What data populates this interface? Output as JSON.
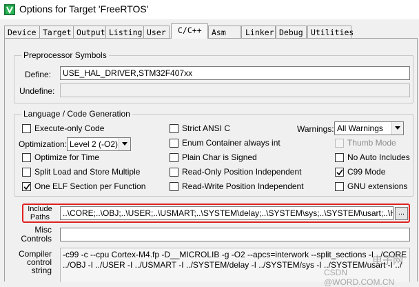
{
  "window": {
    "title": "Options for Target 'FreeRTOS'"
  },
  "tabs": [
    {
      "label": "Device"
    },
    {
      "label": "Target"
    },
    {
      "label": "Output"
    },
    {
      "label": "Listing"
    },
    {
      "label": "User"
    },
    {
      "label": "C/C++",
      "active": true
    },
    {
      "label": "Asm"
    },
    {
      "label": "Linker"
    },
    {
      "label": "Debug"
    },
    {
      "label": "Utilities"
    }
  ],
  "preprocessor": {
    "legend": "Preprocessor Symbols",
    "define_label": "Define:",
    "define_value": "USE_HAL_DRIVER,STM32F407xx",
    "undefine_label": "Undefine:",
    "undefine_value": ""
  },
  "language": {
    "legend": "Language / Code Generation",
    "execute_only": {
      "label": "Execute-only Code",
      "checked": false
    },
    "optimization_label": "Optimization:",
    "optimization_value": "Level 2 (-O2)",
    "optimize_time": {
      "label": "Optimize for Time",
      "checked": false
    },
    "split_load": {
      "label": "Split Load and Store Multiple",
      "checked": false
    },
    "one_elf": {
      "label": "One ELF Section per Function",
      "checked": true
    },
    "strict_ansi": {
      "label": "Strict ANSI C",
      "checked": false
    },
    "enum_container": {
      "label": "Enum Container always int",
      "checked": false
    },
    "plain_char": {
      "label": "Plain Char is Signed",
      "checked": false
    },
    "readonly_pi": {
      "label": "Read-Only Position Independent",
      "checked": false
    },
    "readwrite_pi": {
      "label": "Read-Write Position Independent",
      "checked": false
    },
    "warnings_label": "Warnings:",
    "warnings_value": "All Warnings",
    "thumb_mode": {
      "label": "Thumb Mode",
      "checked": false,
      "disabled": true
    },
    "no_auto_includes": {
      "label": "No Auto Includes",
      "checked": false
    },
    "c99_mode": {
      "label": "C99 Mode",
      "checked": true
    },
    "gnu_extensions": {
      "label": "GNU extensions",
      "checked": false
    }
  },
  "include": {
    "label_line1": "Include",
    "label_line2": "Paths",
    "value": "..\\CORE;..\\OBJ;..\\USER;..\\USMART;..\\SYSTEM\\delay;..\\SYSTEM\\sys;..\\SYSTEM\\usart;..\\HALLI",
    "browse_label": "..."
  },
  "misc": {
    "label_line1": "Misc",
    "label_line2": "Controls",
    "value": ""
  },
  "compiler": {
    "label_line1": "Compiler",
    "label_line2": "control",
    "label_line3": "string",
    "line1": "-c99 -c --cpu Cortex-M4.fp -D__MICROLIB -g -O2 --apcs=interwork --split_sections -I ../CORE -I",
    "line2": "../OBJ -I ../USER -I ../USMART -I ../SYSTEM/delay -I ../SYSTEM/sys -I ../SYSTEM/usart -I ../"
  },
  "watermark": {
    "line1": "电子网",
    "line2": "CSDN @WORD.COM.CN"
  },
  "colors": {
    "highlight_border": "#e02020",
    "window_bg": "#f0f0f0"
  },
  "icons": {
    "app": "keil-uvision-icon",
    "checkmark": "checkmark-icon",
    "dropdown": "chevron-down-icon"
  }
}
